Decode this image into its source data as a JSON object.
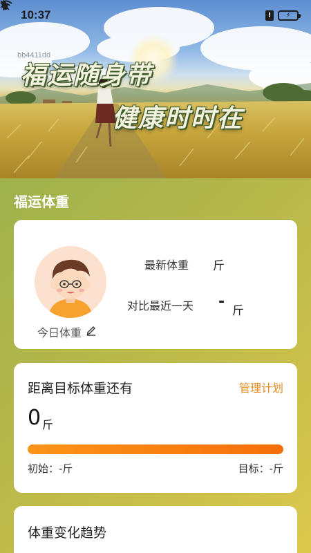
{
  "status_bar": {
    "time": "10:37",
    "icons": [
      "bluetooth-icon",
      "mute-icon",
      "wifi-icon",
      "sim-icon",
      "battery-charging-icon"
    ],
    "sim_label": "!",
    "battery_label": "⚡"
  },
  "hero": {
    "watermark": "bb4411dd",
    "line1": "福运随身带",
    "line2": "健康时时在"
  },
  "section": {
    "title": "福运体重"
  },
  "today_card": {
    "avatar": "boy-avatar",
    "today_label": "今日体重",
    "edit_icon": "pencil-icon",
    "latest_label": "最新体重",
    "latest_value": "斤",
    "compare_label": "对比最近一天",
    "compare_value": "-",
    "compare_unit": "斤"
  },
  "goal_card": {
    "title": "距离目标体重还有",
    "manage_link": "管理计划",
    "remaining_value": "0",
    "remaining_unit": "斤",
    "progress": 1.0,
    "start_label": "初始：-斤",
    "target_label": "目标：-斤",
    "colors": {
      "progress_start": "#fb9418",
      "progress_end": "#f56f0c",
      "link": "#e78a1c"
    }
  },
  "trend_card": {
    "title": "体重变化趋势"
  }
}
